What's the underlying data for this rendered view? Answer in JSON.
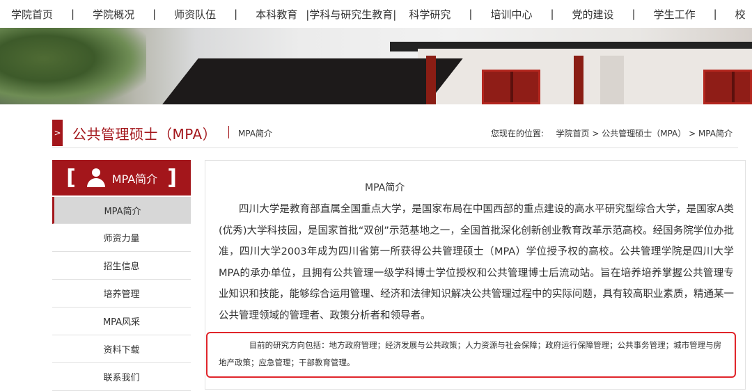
{
  "topnav": {
    "items": [
      "学院首页",
      "学院概况",
      "师资队伍",
      "本科教育",
      "|学科与研究生教育|",
      "科学研究",
      "培训中心",
      "党的建设",
      "学生工作",
      "校"
    ],
    "separator": "|"
  },
  "header": {
    "section_title": "公共管理硕士（MPA）",
    "sub_title": "MPA简介",
    "breadcrumb": {
      "prefix": "您现在的位置:",
      "items": [
        "学院首页",
        "公共管理硕士（MPA）",
        "MPA简介"
      ],
      "separator": " > "
    }
  },
  "sidebar": {
    "heading": "MPA简介",
    "bracket_left": "[",
    "bracket_right": "]",
    "items": [
      {
        "label": "MPA简介",
        "active": true
      },
      {
        "label": "师资力量",
        "active": false
      },
      {
        "label": "招生信息",
        "active": false
      },
      {
        "label": "培养管理",
        "active": false
      },
      {
        "label": "MPA风采",
        "active": false
      },
      {
        "label": "资料下载",
        "active": false
      },
      {
        "label": "联系我们",
        "active": false
      }
    ]
  },
  "content": {
    "title": "MPA简介",
    "paragraph": "四川大学是教育部直属全国重点大学，是国家布局在中国西部的重点建设的高水平研究型综合大学，是国家A类(优秀)大学科技园，是国家首批“双创”示范基地之一，全国首批深化创新创业教育改革示范高校。经国务院学位办批准，四川大学2003年成为四川省第一所获得公共管理硕士（MPA）学位授予权的高校。公共管理学院是四川大学MPA的承办单位，且拥有公共管理一级学科博士学位授权和公共管理博士后流动站。旨在培养培养掌握公共管理专业知识和技能，能够综合运用管理、经济和法律知识解决公共管理过程中的实际问题，具有较高职业素质，精通某一公共管理领域的管理者、政策分析者和领导者。",
    "research_note": "目前的研究方向包括：地方政府管理；经济发展与公共政策；人力资源与社会保障；政府运行保障管理；公共事务管理；城市管理与房地产政策；应急管理；干部教育管理。"
  },
  "colors": {
    "accent": "#a3161b",
    "highlight_border": "#e0252b",
    "active_item_bg": "#d7d7d7"
  },
  "icons": {
    "sidebar_heading": "user-icon",
    "title_mark": "chevron-right-icon"
  }
}
